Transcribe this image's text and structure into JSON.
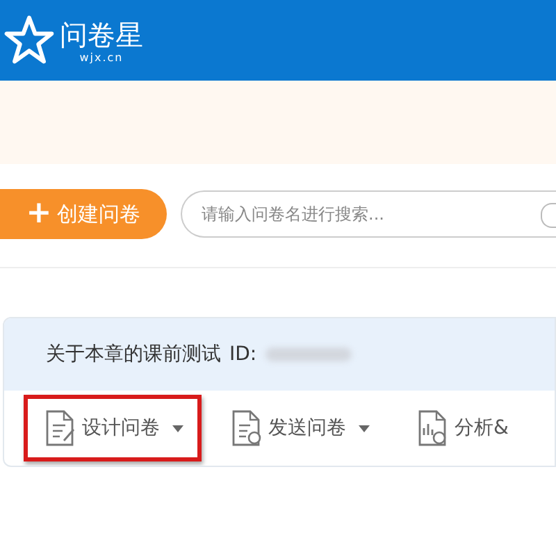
{
  "header": {
    "logo_name": "问卷星",
    "logo_domain": "wjx.cn"
  },
  "create_button": {
    "icon": "+",
    "label": "创建问卷"
  },
  "search": {
    "placeholder": "请输入问卷名进行搜索..."
  },
  "survey": {
    "title": "关于本章的课前测试",
    "id_label": "ID:",
    "tools": [
      {
        "kind": "design",
        "label": "设计问卷",
        "caret": true,
        "highlighted": true
      },
      {
        "kind": "send",
        "label": "发送问卷",
        "caret": true,
        "highlighted": false
      },
      {
        "kind": "analyze",
        "label": "分析&",
        "caret": false,
        "highlighted": false
      }
    ]
  }
}
